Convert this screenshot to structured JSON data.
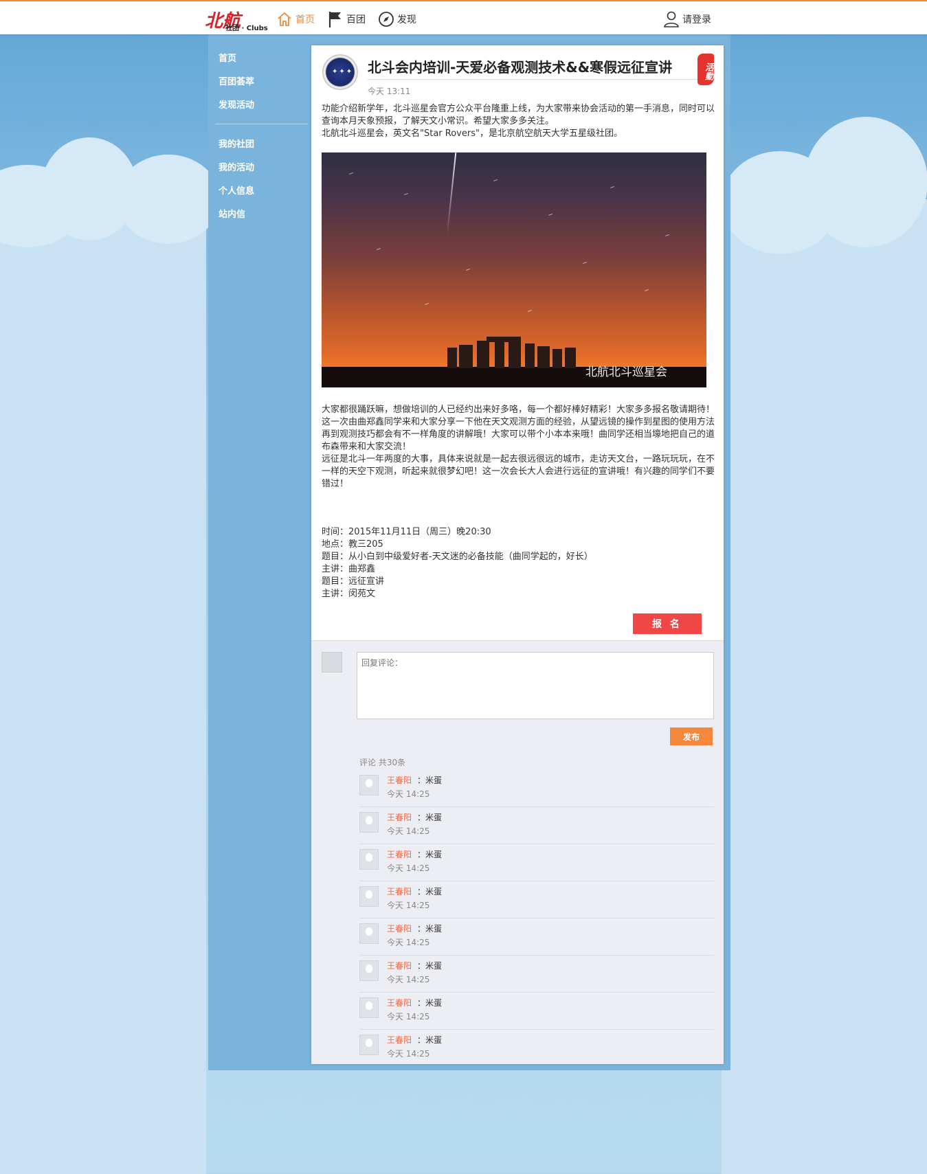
{
  "nav": {
    "logo_script": "北航",
    "logo_text": "社团 · Clubs",
    "home": "首页",
    "clubs": "百团",
    "discover": "发现",
    "login": "请登录",
    "accent": "#f08a3a"
  },
  "sidebar": {
    "items": [
      "首页",
      "百团荟萃",
      "发现活动",
      "我的社团",
      "我的活动",
      "个人信息",
      "站内信"
    ]
  },
  "post": {
    "title": "北斗会内培训-天爱必备观测技术&&寒假远征宣讲",
    "time": "今天 13:11",
    "seal": "活動",
    "intro_1": "功能介绍新学年，北斗巡星会官方公众平台隆重上线，为大家带来协会活动的第一手消息，同时可以查询本月天象预报，了解天文小常识。希望大家多多关注。",
    "intro_2": "北航北斗巡星会，英文名\"Star Rovers\"，是北京航空航天大学五星级社团。",
    "photo_watermark": "北航北斗巡星会",
    "body_1": "大家都很踊跃嘛，想做培训的人已经约出来好多咯，每一个都好棒好精彩！大家多多报名敬请期待！",
    "body_2": "这一次由曲郑鑫同学来和大家分享一下他在天文观测方面的经验，从望远镜的操作到星图的使用方法再到观测技巧都会有不一样角度的讲解哦！大家可以带个小本本来哦！曲同学还相当壕地把自己的道布森带来和大家交流！",
    "body_3": "远征是北斗一年两度的大事，具体来说就是一起去很远很远的城市，走访天文台，一路玩玩玩，在不一样的天空下观测，听起来就很梦幻吧！这一次会长大人会进行远征的宣讲哦！有兴趣的同学们不要错过！",
    "details": [
      "时间：2015年11月11日（周三）晚20:30",
      "地点：教三205",
      "题目：从小白到中级爱好者-天文迷的必备技能（曲同学起的，好长）",
      "主讲：曲郑鑫",
      "题目：远征宣讲",
      "主讲：闵苑文"
    ],
    "signup_label": "报 名",
    "signup_color": "#f04646"
  },
  "comments": {
    "placeholder": "回复评论：",
    "publish_label": "发布",
    "count_label": "评论 共30条",
    "items": [
      {
        "user": "王春阳",
        "sep": "：",
        "text": "米蛋",
        "time": "今天 14:25"
      },
      {
        "user": "王春阳",
        "sep": "：",
        "text": "米蛋",
        "time": "今天 14:25"
      },
      {
        "user": "王春阳",
        "sep": "：",
        "text": "米蛋",
        "time": "今天 14:25"
      },
      {
        "user": "王春阳",
        "sep": "：",
        "text": "米蛋",
        "time": "今天 14:25"
      },
      {
        "user": "王春阳",
        "sep": "：",
        "text": "米蛋",
        "time": "今天 14:25"
      },
      {
        "user": "王春阳",
        "sep": "：",
        "text": "米蛋",
        "time": "今天 14:25"
      },
      {
        "user": "王春阳",
        "sep": "：",
        "text": "米蛋",
        "time": "今天 14:25"
      },
      {
        "user": "王春阳",
        "sep": "：",
        "text": "米蛋",
        "time": "今天 14:25"
      }
    ]
  }
}
